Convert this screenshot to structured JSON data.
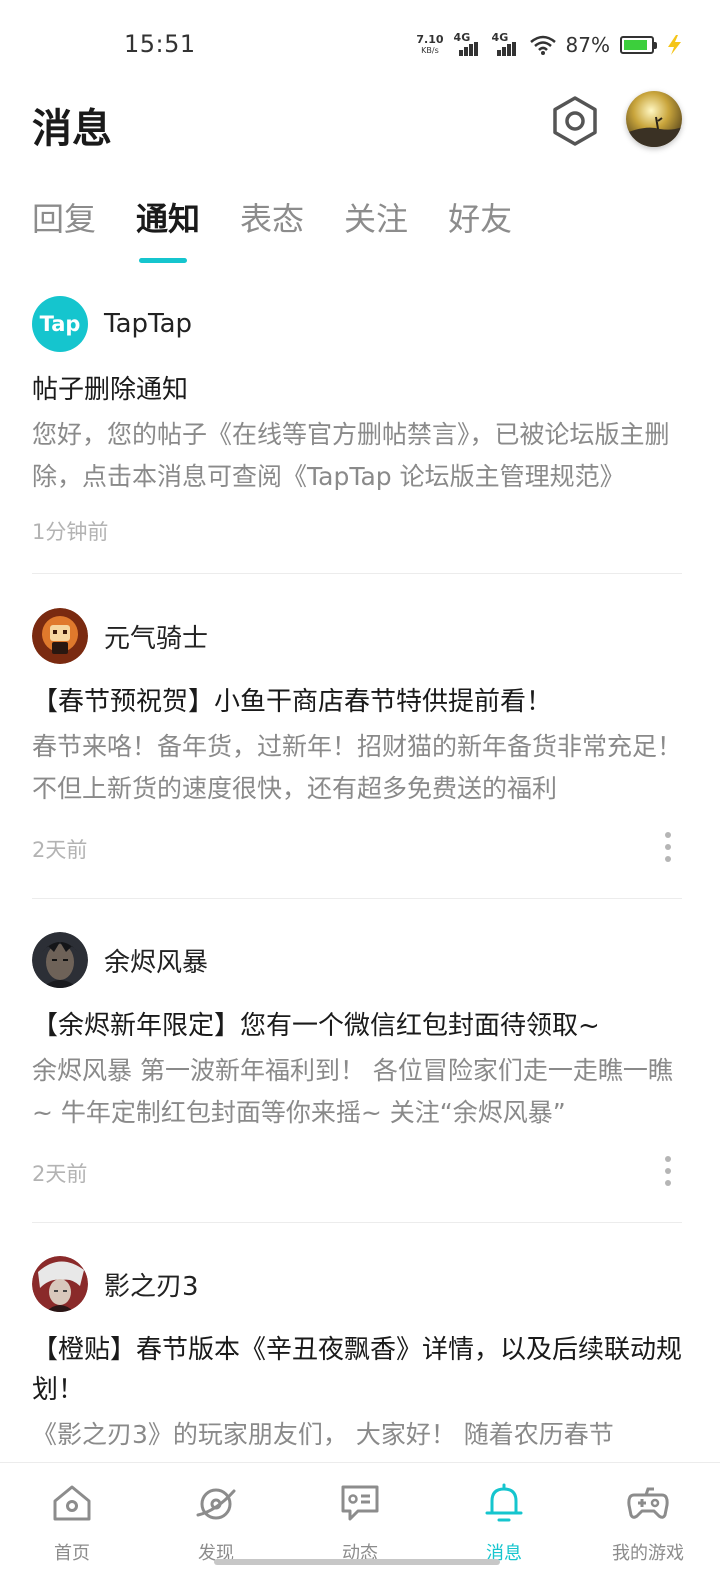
{
  "status_bar": {
    "time": "15:51",
    "net_speed_value": "7.10",
    "net_speed_unit": "KB/s",
    "signal1_label": "4G",
    "signal2_label": "4G",
    "battery_percent": "87%",
    "battery_level": 0.87,
    "battery_color": "#3ccf3c"
  },
  "header": {
    "title": "消息",
    "settings_icon": "hexagon-settings-icon",
    "avatar_icon": "user-avatar"
  },
  "tabs": [
    {
      "label": "回复",
      "active": false
    },
    {
      "label": "通知",
      "active": true
    },
    {
      "label": "表态",
      "active": false
    },
    {
      "label": "关注",
      "active": false
    },
    {
      "label": "好友",
      "active": false
    }
  ],
  "accent_color": "#15c5ce",
  "notifications": [
    {
      "source": "TapTap",
      "logo_text": "Tap",
      "title": "帖子删除通知",
      "body": "您好，您的帖子《在线等官方删帖禁言》，已被论坛版主删除，点击本消息可查阅《TapTap 论坛版主管理规范》",
      "time": "1分钟前"
    },
    {
      "source": "元气骑士",
      "title": "【春节预祝贺】小鱼干商店春节特供提前看！",
      "body": "春节来咯！备年货，过新年！招财猫的新年备货非常充足！不但上新货的速度很快，还有超多免费送的福利",
      "time": "2天前"
    },
    {
      "source": "余烬风暴",
      "title": "【余烬新年限定】您有一个微信红包封面待领取~",
      "body": "余烬风暴  第一波新年福利到！ 各位冒险家们走一走瞧一瞧~ 牛年定制红包封面等你来摇~ 关注“余烬风暴”",
      "time": "2天前"
    },
    {
      "source": "影之刃3",
      "title": "【橙贴】春节版本《辛丑夜飘香》详情，以及后续联动规划！",
      "body": "《影之刃3》的玩家朋友们， 大家好！ 随着农历春节"
    }
  ],
  "bottom_nav": [
    {
      "label": "首页",
      "icon": "home-icon",
      "active": false
    },
    {
      "label": "发现",
      "icon": "discover-planet-icon",
      "active": false
    },
    {
      "label": "动态",
      "icon": "feed-chat-icon",
      "active": false
    },
    {
      "label": "消息",
      "icon": "bell-icon",
      "active": true
    },
    {
      "label": "我的游戏",
      "icon": "gamepad-icon",
      "active": false
    }
  ]
}
